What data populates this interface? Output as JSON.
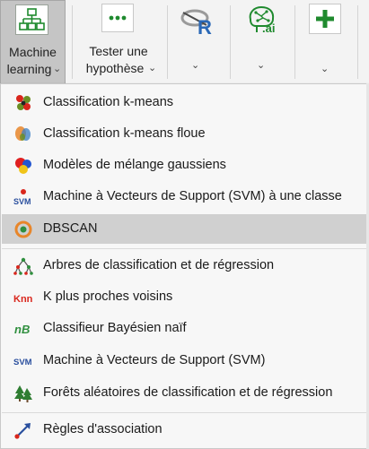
{
  "ribbon": {
    "ml": {
      "line1": "Machine",
      "line2": "learning",
      "chevron": "⌄",
      "icon": "network-diagram-icon"
    },
    "hyp": {
      "line1": "Tester une",
      "line2": "hypothèse",
      "chevron": "⌄",
      "icon": "ellipsis-box-icon"
    },
    "r": {
      "chevron": "⌄",
      "icon": "r-language-icon"
    },
    "ai": {
      "chevron": "⌄",
      "icon": "brain-ai-icon",
      "badge": ".ai"
    },
    "add": {
      "chevron": "⌄",
      "icon": "plus-icon"
    }
  },
  "colors": {
    "accent_green": "#1f8a2e",
    "highlight": "#d0d0d0",
    "r_blue": "#2a68b6"
  },
  "menu": {
    "items": [
      {
        "label": "Classification k-means",
        "icon": "kmeans-clusters-icon"
      },
      {
        "label": "Classification k-means floue",
        "icon": "fuzzy-kmeans-icon"
      },
      {
        "label": "Modèles de mélange gaussiens",
        "icon": "gaussian-mixture-icon"
      },
      {
        "label": "Machine à Vecteurs de Support (SVM) à une classe",
        "icon": "one-class-svm-icon",
        "icon_text": "SVM"
      },
      {
        "label": "DBSCAN",
        "icon": "dbscan-icon"
      },
      {
        "label": "Arbres de classification et de régression",
        "icon": "decision-tree-icon"
      },
      {
        "label": "K plus proches voisins",
        "icon": "knn-icon",
        "icon_text": "Knn"
      },
      {
        "label": "Classifieur Bayésien naïf",
        "icon": "naive-bayes-icon",
        "icon_text": "nB"
      },
      {
        "label": "Machine à Vecteurs de Support (SVM)",
        "icon": "svm-icon",
        "icon_text": "SVM"
      },
      {
        "label": "Forêts aléatoires de classification et de régression",
        "icon": "random-forest-icon"
      },
      {
        "label": "Règles d'association",
        "icon": "association-rules-icon"
      }
    ]
  }
}
